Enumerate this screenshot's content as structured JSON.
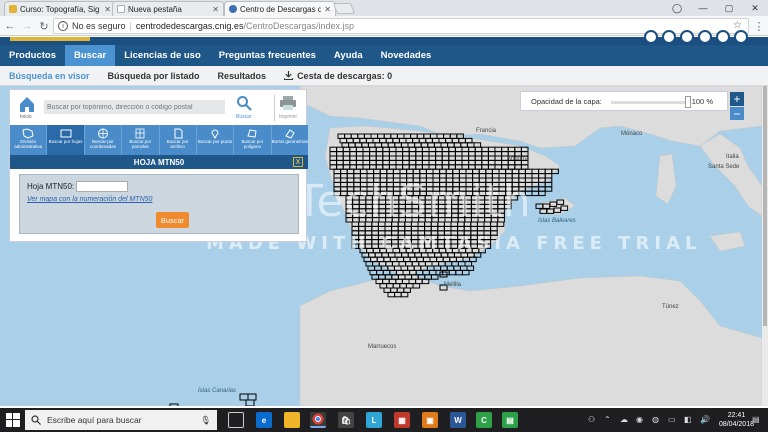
{
  "browser": {
    "tabs": [
      {
        "title": "Curso: Topografía, Sig Y",
        "active": false
      },
      {
        "title": "Nueva pestaña",
        "active": false
      },
      {
        "title": "Centro de Descargas del",
        "active": true
      }
    ],
    "security_label": "No es seguro",
    "url_host": "centrodedescargas.cnig.es",
    "url_path": "/CentroDescargas/index.jsp"
  },
  "mainnav": {
    "items": [
      "Productos",
      "Buscar",
      "Licencias de uso",
      "Preguntas frecuentes",
      "Ayuda",
      "Novedades"
    ],
    "active": "Buscar"
  },
  "subnav": {
    "items": [
      "Búsqueda en visor",
      "Búsqueda por listado",
      "Resultados"
    ],
    "cart": "Cesta de descargas: 0"
  },
  "panel": {
    "home_label": "Inicio",
    "search_placeholder": "Buscar por topónimo, dirección o código postal",
    "search_label": "Buscar",
    "print_label": "Imprimir",
    "modes": [
      "División administrativa",
      "Buscar por hojas",
      "Buscar por coordenadas",
      "Buscar por parcelas",
      "Buscar por archivo",
      "Buscar por punto",
      "Buscar por polígono",
      "Borrar geometrías"
    ],
    "hoja_title": "HOJA MTN50",
    "hoja_close": "X",
    "hoja_field_label": "Hoja MTN50:",
    "hoja_field_value": "",
    "hoja_link": "Ver mapa con la numeración del MTN50",
    "hoja_button": "Buscar"
  },
  "opacity": {
    "label": "Opacidad de la capa:",
    "value_text": "100 %",
    "level": 1.0
  },
  "zoom": {
    "in": "+",
    "out": "−"
  },
  "map_labels": {
    "francia": "Francia",
    "monaco": "Mónaco",
    "italia": "Italia",
    "santa_sede": "Santa Sede",
    "andorra": "Andorra",
    "islas_baleares": "Islas Baleares",
    "melilla": "Melilla",
    "marruecos": "Marruecos",
    "tunez": "Túnez",
    "islas_canarias": "Islas Canarias",
    "madrid": "Madrid",
    "barcelona": "Barcelona"
  },
  "watermark": {
    "main": "TechSmith",
    "sub": "MADE WITH CAMTASIA FREE TRIAL"
  },
  "taskbar": {
    "search_placeholder": "Escribe aquí para buscar",
    "time": "22:41",
    "date": "08/04/2018"
  },
  "colors": {
    "nav_dark": "#1f5788",
    "nav_active": "#4c93d2",
    "sea": "#a9d0e8",
    "land": "#dcdcdc",
    "button_orange": "#f08a2e"
  }
}
